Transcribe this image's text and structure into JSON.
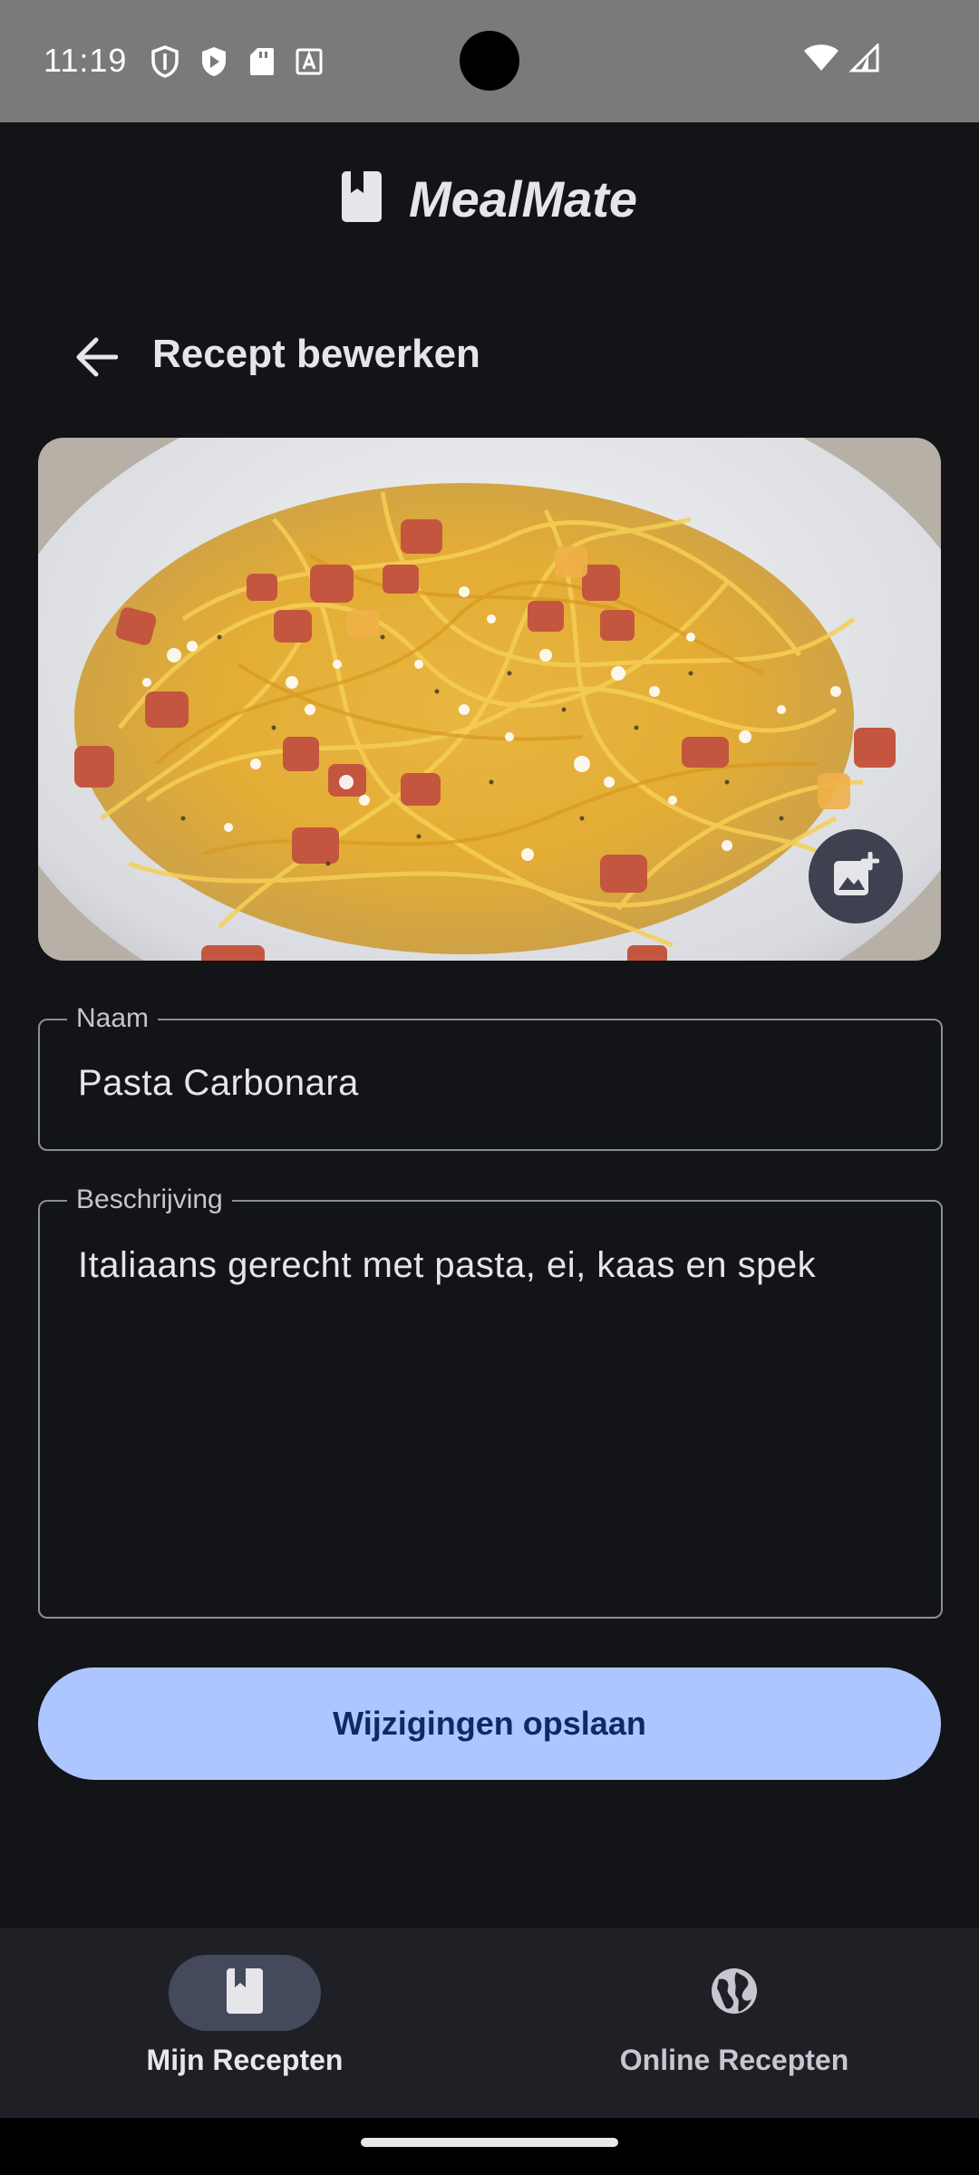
{
  "status_bar": {
    "time": "11:19",
    "icons": [
      "shield-outline-icon",
      "play-shield-icon",
      "sd-card-icon",
      "keyboard-a-icon",
      "wifi-icon",
      "signal-icon"
    ]
  },
  "app": {
    "name": "MealMate",
    "logo_icon": "book-icon"
  },
  "top_bar": {
    "title": "Recept bewerken",
    "back_icon": "arrow-back-icon"
  },
  "recipe_image": {
    "subject": "pasta carbonara",
    "add_photo_icon": "add-photo-icon"
  },
  "form": {
    "name_label": "Naam",
    "name_value": "Pasta Carbonara",
    "description_label": "Beschrijving",
    "description_value": "Italiaans gerecht met pasta, ei, kaas en spek"
  },
  "save_button": {
    "label": "Wijzigingen opslaan"
  },
  "bottom_nav": {
    "items": [
      {
        "label": "Mijn Recepten",
        "icon": "book-icon",
        "active": true
      },
      {
        "label": "Online Recepten",
        "icon": "globe-icon",
        "active": false
      }
    ]
  },
  "colors": {
    "background": "#131418",
    "primary_button": "#aec6ff",
    "primary_button_text": "#0f2a63",
    "nav_background": "#1f2026",
    "active_pill": "#444a5c",
    "status_bar": "#7a7a7a"
  }
}
